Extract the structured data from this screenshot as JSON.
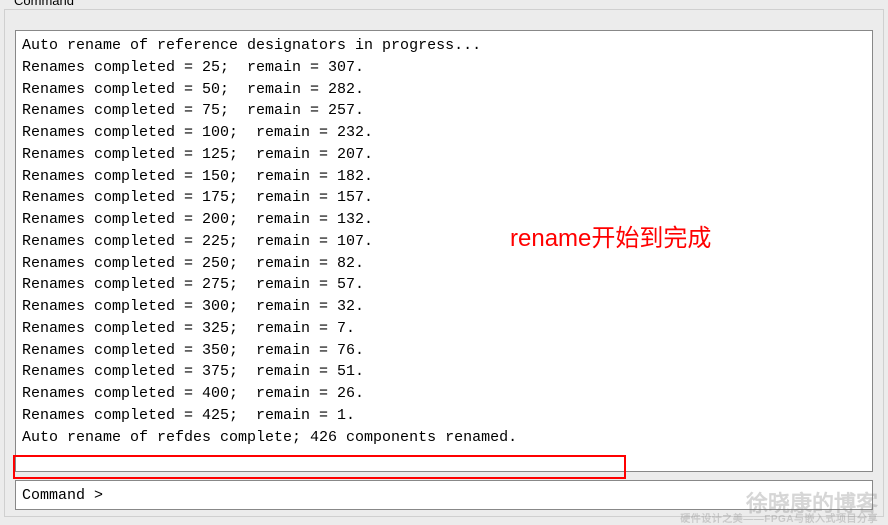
{
  "panel": {
    "title": "Command"
  },
  "log": {
    "header": "Auto rename of reference designators in progress...",
    "rows": [
      {
        "completed": 25,
        "remain": 307
      },
      {
        "completed": 50,
        "remain": 282
      },
      {
        "completed": 75,
        "remain": 257
      },
      {
        "completed": 100,
        "remain": 232
      },
      {
        "completed": 125,
        "remain": 207
      },
      {
        "completed": 150,
        "remain": 182
      },
      {
        "completed": 175,
        "remain": 157
      },
      {
        "completed": 200,
        "remain": 132
      },
      {
        "completed": 225,
        "remain": 107
      },
      {
        "completed": 250,
        "remain": 82
      },
      {
        "completed": 275,
        "remain": 57
      },
      {
        "completed": 300,
        "remain": 32
      },
      {
        "completed": 325,
        "remain": 7
      },
      {
        "completed": 350,
        "remain": 76
      },
      {
        "completed": 375,
        "remain": 51
      },
      {
        "completed": 400,
        "remain": 26
      },
      {
        "completed": 425,
        "remain": 1
      }
    ],
    "footer": "Auto rename of refdes complete; 426 components renamed.",
    "row_template": "Renames completed = {c};  remain = {r}."
  },
  "prompt": {
    "label": "Command > ",
    "value": ""
  },
  "annotation": {
    "text": "rename开始到完成"
  },
  "watermark": {
    "main": "徐晓康的博客",
    "sub": "硬件设计之美——FPGA与嵌入式项目分享"
  }
}
